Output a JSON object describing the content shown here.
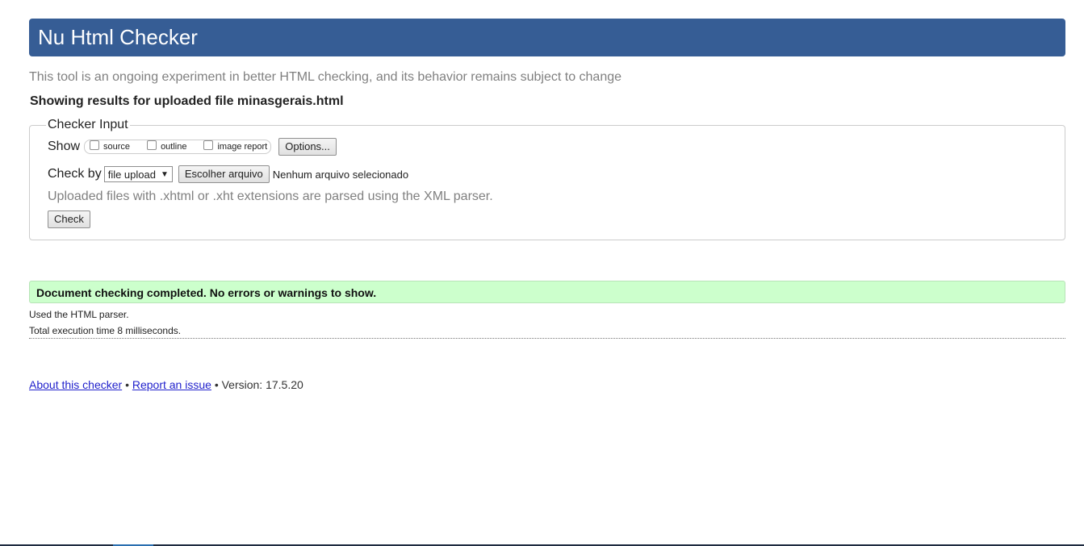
{
  "header": {
    "title": "Nu Html Checker"
  },
  "tagline": "This tool is an ongoing experiment in better HTML checking, and its behavior remains subject to change",
  "showing": "Showing results for uploaded file minasgerais.html",
  "checker_input": {
    "legend": "Checker Input",
    "show_label": "Show",
    "show_options": [
      {
        "label": "source",
        "checked": false
      },
      {
        "label": "outline",
        "checked": false
      },
      {
        "label": "image report",
        "checked": false
      }
    ],
    "options_button": "Options...",
    "check_by_label": "Check by",
    "check_by_value": "file upload",
    "choose_file_button": "Escolher arquivo",
    "no_file_text": "Nenhum arquivo selecionado",
    "note": "Uploaded files with .xhtml or .xht extensions are parsed using the XML parser.",
    "check_button": "Check"
  },
  "result": {
    "message": "Document checking completed. No errors or warnings to show.",
    "parser": "Used the HTML parser.",
    "execution_time": "Total execution time 8 milliseconds."
  },
  "footer": {
    "about_link": "About this checker",
    "separator": "•",
    "report_link": "Report an issue",
    "version": "Version: 17.5.20"
  }
}
